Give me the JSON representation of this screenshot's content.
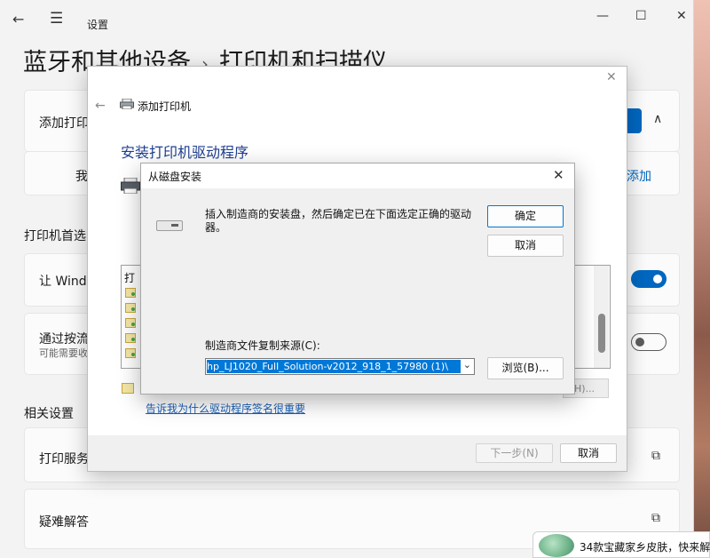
{
  "settings": {
    "app_title": "设置",
    "breadcrumb": {
      "parent": "蓝牙和其他设备",
      "separator": "›",
      "current": "打印机和扫描仪"
    },
    "cards": {
      "add_printer_label": "添加打印",
      "not_listed_label": "我",
      "add_manually_link": "添加",
      "let_windows_label": "让 Windo",
      "metered_label": "通过按流",
      "metered_sub": "可能需要收",
      "print_server_label": "打印服务",
      "troubleshoot_label": "疑难解答"
    },
    "sections": {
      "printer_prefs": "打印机首选",
      "related": "相关设置"
    },
    "toggles": {
      "let_windows_manage": true,
      "metered_download": false
    }
  },
  "add_printer_dialog": {
    "title": "添加打印机",
    "heading": "安装打印机驱动程序",
    "list_header_fragment": "打",
    "list_rows": 5,
    "hidden_button_fragment": "H)...",
    "driver_signing_link": "告诉我为什么驱动程序签名很重要",
    "next_button": "下一步(N)",
    "cancel_button": "取消"
  },
  "install_from_disk_dialog": {
    "title": "从磁盘安装",
    "message": "插入制造商的安装盘，然后确定已在下面选定正确的驱动器。",
    "ok_button": "确定",
    "cancel_button": "取消",
    "source_label": "制造商文件复制来源(C):",
    "source_value": "\\hp_LJ1020_Full_Solution-v2012_918_1_57980 (1)",
    "browse_button": "浏览(B)..."
  },
  "toast": {
    "text": "34款宝藏家乡皮肤，快来解"
  }
}
